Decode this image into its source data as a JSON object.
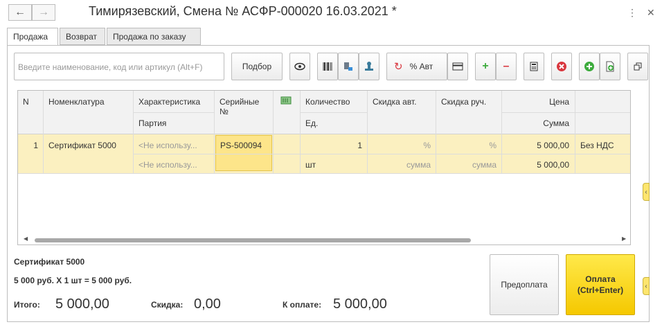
{
  "header": {
    "title": "Тимирязевский, Смена № АСФР-000020  16.03.2021 *",
    "back_icon": "arrow-left-icon",
    "forward_icon": "arrow-right-icon"
  },
  "tabs": [
    {
      "label": "Продажа"
    },
    {
      "label": "Возврат"
    },
    {
      "label": "Продажа по заказу"
    }
  ],
  "toolbar": {
    "search_placeholder": "Введите наименование, код или артикул (Alt+F)",
    "select_label": "Подбор",
    "auto_discount_label": "% Авт"
  },
  "table": {
    "headers": {
      "n": "N",
      "item": "Номенклатура",
      "characteristic": "Характеристика",
      "batch": "Партия",
      "serial": "Серийные №",
      "quantity": "Количество",
      "unit": "Ед.",
      "auto_discount": "Скидка авт.",
      "manual_discount": "Скидка руч.",
      "price": "Цена",
      "amount": "Сумма"
    },
    "rows": [
      {
        "n": "1",
        "item": "Сертификат 5000",
        "characteristic": "<Не использу...",
        "batch": "<Не использу...",
        "serial": "PS-500094",
        "quantity": "1",
        "unit": "шт",
        "auto_discount_pct": "%",
        "auto_discount_sum": "сумма",
        "manual_discount_pct": "%",
        "manual_discount_sum": "сумма",
        "price": "5 000,00",
        "amount": "5 000,00",
        "vat": "Без НДС"
      }
    ]
  },
  "summary": {
    "item_name": "Сертификат 5000",
    "calc_line": "5 000 руб. X 1 шт = 5 000 руб.",
    "total_label": "Итого:",
    "total_value": "5 000,00",
    "discount_label": "Скидка:",
    "discount_value": "0,00",
    "to_pay_label": "К оплате:",
    "to_pay_value": "5 000,00"
  },
  "actions": {
    "prepay_label": "Предоплата",
    "pay_label": "Оплата\n(Ctrl+Enter)"
  },
  "colors": {
    "accent_yellow": "#fdd835",
    "row_highlight": "#fbf0c0",
    "add_green": "#3cab3c",
    "remove_red": "#d9363e"
  }
}
